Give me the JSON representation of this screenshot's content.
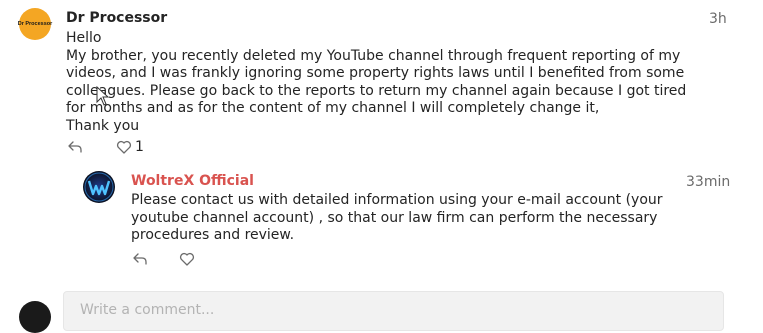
{
  "comment": {
    "author": "Dr Processor",
    "avatar_text": "Dr Processor",
    "time": "3h",
    "text": "Hello\nMy brother, you recently deleted my YouTube channel through frequent reporting of my videos, and I was frankly ignoring some property rights laws until I benefited from some colleagues. Please go back to the reports to return my channel again because I got tired for months and as for the content of my channel I will completely change it,\nThank you",
    "like_count": "1"
  },
  "reply": {
    "author": "WoltreX Official",
    "time": "33min",
    "text": "Please contact us with detailed information using your e-mail account (your youtube channel account) , so that our law firm can perform the necessary procedures and review."
  },
  "composer": {
    "placeholder": "Write a comment..."
  },
  "colors": {
    "accent_author": "#d9534f",
    "dr_avatar": "#f4a623"
  },
  "icons": [
    "reply-icon",
    "heart-icon",
    "cursor-icon"
  ]
}
